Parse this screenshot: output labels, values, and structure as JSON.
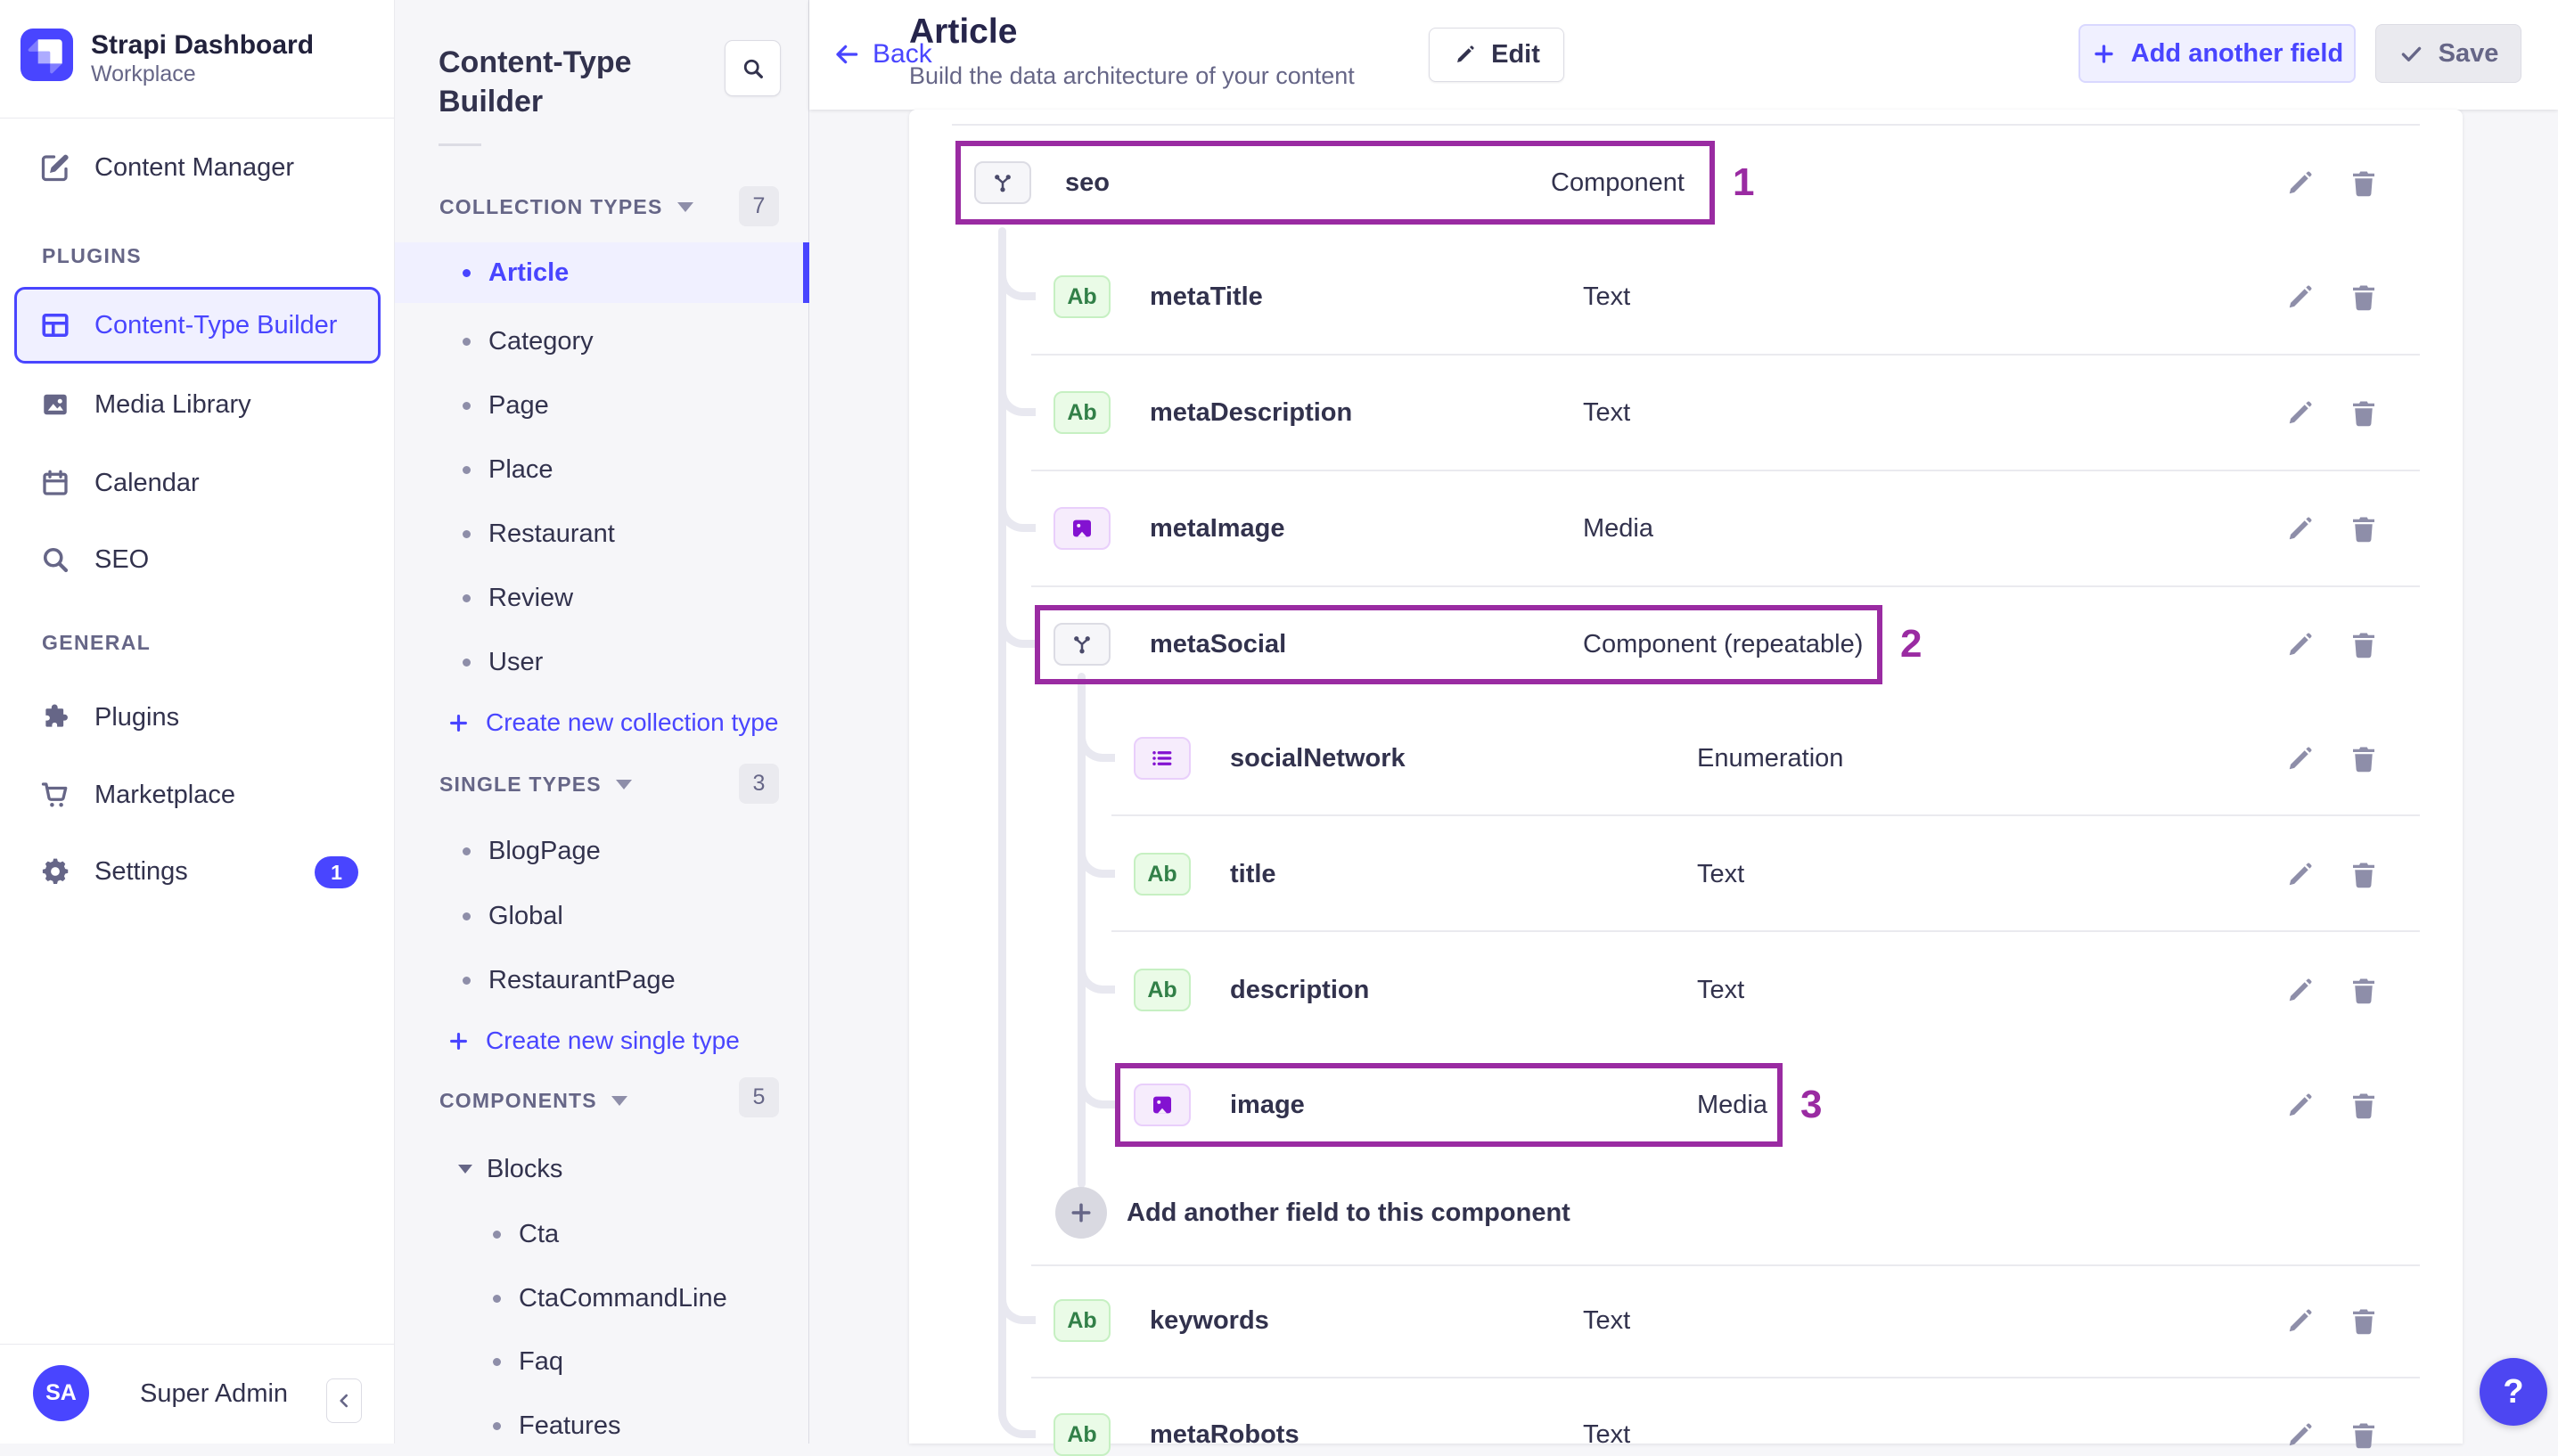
{
  "brand": {
    "app_name": "Strapi Dashboard",
    "workspace": "Workplace"
  },
  "main_nav": {
    "content_manager": "Content Manager",
    "plugins_section": "PLUGINS",
    "general_section": "GENERAL",
    "ctb": "Content-Type Builder",
    "media_library": "Media Library",
    "calendar": "Calendar",
    "seo": "SEO",
    "plugins": "Plugins",
    "marketplace": "Marketplace",
    "settings": "Settings",
    "settings_badge": "1",
    "user": {
      "initials": "SA",
      "name": "Super Admin"
    }
  },
  "panel": {
    "title": "Content-Type Builder",
    "collection": {
      "label": "COLLECTION TYPES",
      "count": "7",
      "items": [
        "Article",
        "Category",
        "Page",
        "Place",
        "Restaurant",
        "Review",
        "User"
      ],
      "create": "Create new collection type"
    },
    "single": {
      "label": "SINGLE TYPES",
      "count": "3",
      "items": [
        "BlogPage",
        "Global",
        "RestaurantPage"
      ],
      "create": "Create new single type"
    },
    "components": {
      "label": "COMPONENTS",
      "count": "5",
      "group": "Blocks",
      "items": [
        "Cta",
        "CtaCommandLine",
        "Faq",
        "Features"
      ]
    }
  },
  "header": {
    "back": "Back",
    "title": "Article",
    "subtitle": "Build the data architecture of your content",
    "edit": "Edit",
    "add_field": "Add another field",
    "save": "Save"
  },
  "fields": {
    "rows": [
      {
        "name": "seo",
        "type": "Component",
        "annotation": "1"
      },
      {
        "name": "metaTitle",
        "type": "Text"
      },
      {
        "name": "metaDescription",
        "type": "Text"
      },
      {
        "name": "metaImage",
        "type": "Media"
      },
      {
        "name": "metaSocial",
        "type": "Component (repeatable)",
        "annotation": "2"
      },
      {
        "name": "socialNetwork",
        "type": "Enumeration"
      },
      {
        "name": "title",
        "type": "Text"
      },
      {
        "name": "description",
        "type": "Text"
      },
      {
        "name": "image",
        "type": "Media",
        "annotation": "3"
      },
      {
        "name": "keywords",
        "type": "Text"
      },
      {
        "name": "metaRobots",
        "type": "Text"
      }
    ],
    "add_component_field": "Add another field to this component"
  },
  "help_label": "?",
  "colors": {
    "primary": "#4945FF",
    "annotation": "#9A2BA2",
    "panel_bg": "#F6F6F9"
  }
}
